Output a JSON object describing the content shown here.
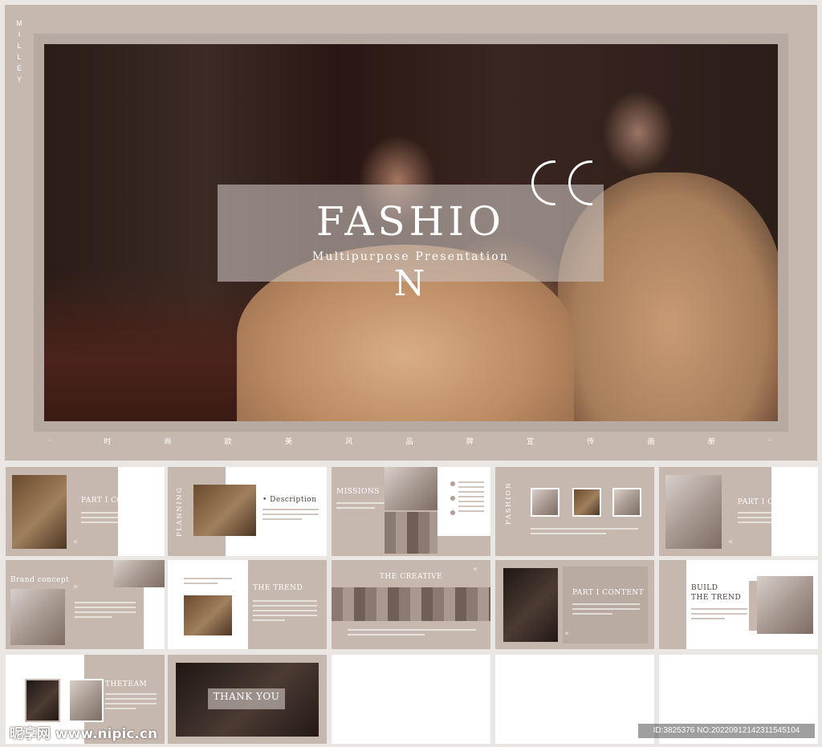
{
  "hero": {
    "brand_vertical": "MILLEY",
    "title": "FASHIO",
    "title_last_letter": "N",
    "subtitle": "Multipurpose Presentation",
    "tagline_chars": [
      "·",
      "时",
      "尚",
      "欧",
      "美",
      "风",
      "品",
      "牌",
      "宣",
      "传",
      "画",
      "册",
      "·"
    ]
  },
  "thumbnails": {
    "s1": {
      "heading": "PART I CONTENT"
    },
    "s2": {
      "vertical": "PLANNING",
      "heading": "• Description"
    },
    "s3": {
      "heading": "MISSIONS"
    },
    "s4": {
      "vertical": "FASHION"
    },
    "s5": {
      "heading": "PART I CONTENT"
    },
    "s6": {
      "heading": "Brand concept"
    },
    "s7": {
      "heading": "THE TREND"
    },
    "s8": {
      "heading": "THE CREATIVE"
    },
    "s9": {
      "heading": "PART I CONTENT"
    },
    "s10": {
      "heading_line1": "BUILD",
      "heading_line2": "THE TREND"
    },
    "s11": {
      "heading": "THETEAM"
    },
    "s12": {
      "heading": "THANK YOU"
    }
  },
  "watermark": {
    "logo": "昵享网 www.nipic.cn",
    "id": "ID:3825376 NO:20220912142311545104"
  }
}
